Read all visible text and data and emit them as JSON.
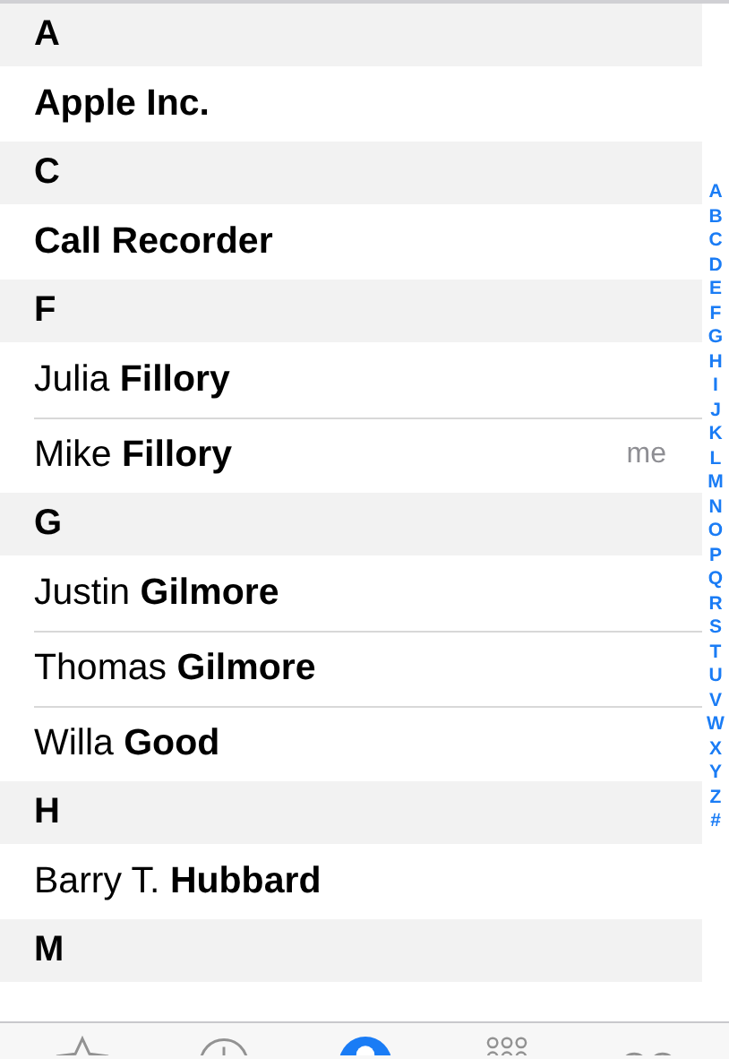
{
  "sections": [
    {
      "letter": "A",
      "contacts": [
        {
          "kind": "company",
          "name": "Apple Inc."
        }
      ]
    },
    {
      "letter": "C",
      "contacts": [
        {
          "kind": "company",
          "name": "Call Recorder"
        }
      ]
    },
    {
      "letter": "F",
      "contacts": [
        {
          "kind": "person",
          "name": "Julia **Fillory**"
        },
        {
          "kind": "person",
          "name": "Mike **Fillory**",
          "note": "me"
        }
      ]
    },
    {
      "letter": "G",
      "contacts": [
        {
          "kind": "person",
          "name": "Justin **Gilmore**"
        },
        {
          "kind": "person",
          "name": "Thomas **Gilmore**"
        },
        {
          "kind": "person",
          "name": "Willa **Good**"
        }
      ]
    },
    {
      "letter": "H",
      "contacts": [
        {
          "kind": "person",
          "name": "Barry T. **Hubbard**"
        }
      ]
    },
    {
      "letter": "M"
    }
  ],
  "index": [
    "A",
    "B",
    "C",
    "D",
    "E",
    "F",
    "G",
    "H",
    "I",
    "J",
    "K",
    "L",
    "M",
    "N",
    "O",
    "P",
    "Q",
    "R",
    "S",
    "T",
    "U",
    "V",
    "W",
    "X",
    "Y",
    "Z",
    "#"
  ],
  "tabs": [
    {
      "kind": "favorites",
      "selected": false
    },
    {
      "kind": "recents",
      "selected": false
    },
    {
      "kind": "contacts",
      "selected": true
    },
    {
      "kind": "keypad",
      "selected": false
    },
    {
      "kind": "voicemail",
      "selected": false
    }
  ]
}
